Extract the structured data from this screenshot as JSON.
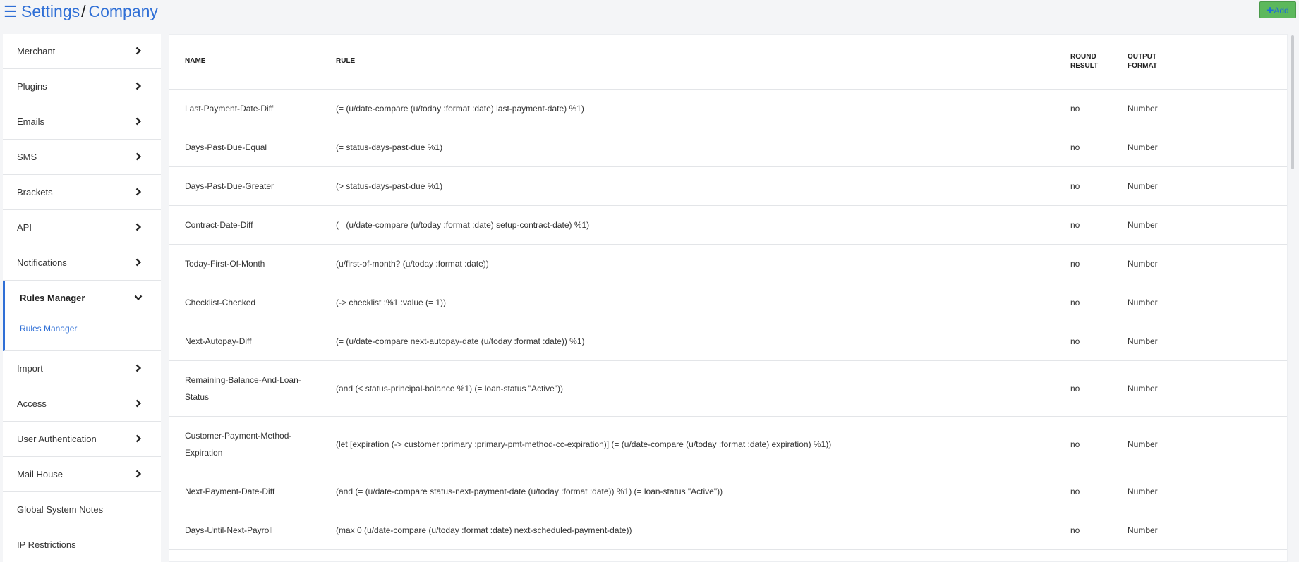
{
  "header": {
    "menu_icon": "hamburger-icon",
    "breadcrumb_root": "Settings",
    "breadcrumb_separator": "/",
    "breadcrumb_current": "Company",
    "add_button_label": "✚Add",
    "accent_color": "#2f6fd6",
    "add_button_color": "#5cb85c"
  },
  "sidebar": {
    "items": [
      {
        "label": "Merchant"
      },
      {
        "label": "Plugins"
      },
      {
        "label": "Emails"
      },
      {
        "label": "SMS"
      },
      {
        "label": "Brackets"
      },
      {
        "label": "API"
      },
      {
        "label": "Notifications"
      },
      {
        "label": "Rules Manager",
        "sub": "Rules Manager"
      },
      {
        "label": "Import"
      },
      {
        "label": "Access"
      },
      {
        "label": "User Authentication"
      },
      {
        "label": "Mail House"
      },
      {
        "label": "Global System Notes"
      },
      {
        "label": "IP Restrictions"
      }
    ]
  },
  "table": {
    "columns": {
      "name": "NAME",
      "rule": "RULE",
      "round_1": "ROUND",
      "round_2": "RESULT",
      "output_1": "OUTPUT",
      "output_2": "FORMAT"
    },
    "rows": [
      {
        "name": "Last-Payment-Date-Diff",
        "rule": "(= (u/date-compare (u/today :format :date) last-payment-date) %1)",
        "round": "no",
        "output": "Number"
      },
      {
        "name": "Days-Past-Due-Equal",
        "rule": "(= status-days-past-due %1)",
        "round": "no",
        "output": "Number"
      },
      {
        "name": "Days-Past-Due-Greater",
        "rule": "(> status-days-past-due %1)",
        "round": "no",
        "output": "Number"
      },
      {
        "name": "Contract-Date-Diff",
        "rule": "(= (u/date-compare (u/today :format :date) setup-contract-date) %1)",
        "round": "no",
        "output": "Number"
      },
      {
        "name": "Today-First-Of-Month",
        "rule": "(u/first-of-month? (u/today :format :date))",
        "round": "no",
        "output": "Number"
      },
      {
        "name": "Checklist-Checked",
        "rule": "(-> checklist :%1 :value (= 1))",
        "round": "no",
        "output": "Number"
      },
      {
        "name": "Next-Autopay-Diff",
        "rule": "(= (u/date-compare next-autopay-date (u/today :format :date)) %1)",
        "round": "no",
        "output": "Number"
      },
      {
        "name": "Remaining-Balance-And-Loan-Status",
        "rule": "(and (< status-principal-balance %1) (= loan-status \"Active\"))",
        "round": "no",
        "output": "Number"
      },
      {
        "name": "Customer-Payment-Method-Expiration",
        "rule": "(let [expiration (-> customer :primary :primary-pmt-method-cc-expiration)] (= (u/date-compare (u/today :format :date) expiration) %1))",
        "round": "no",
        "output": "Number"
      },
      {
        "name": "Next-Payment-Date-Diff",
        "rule": "(and (= (u/date-compare status-next-payment-date (u/today :format :date)) %1) (= loan-status \"Active\"))",
        "round": "no",
        "output": "Number"
      },
      {
        "name": "Days-Until-Next-Payroll",
        "rule": "(max 0 (u/date-compare (u/today :format :date) next-scheduled-payment-date))",
        "round": "no",
        "output": "Number"
      }
    ]
  }
}
